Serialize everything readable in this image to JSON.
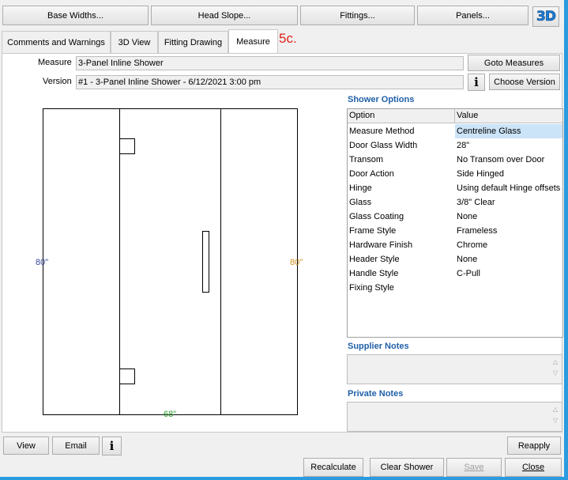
{
  "toolbar": {
    "base_widths": "Base Widths...",
    "head_slope": "Head Slope...",
    "fittings": "Fittings...",
    "panels": "Panels...",
    "view_3d": "3D"
  },
  "tabs": [
    {
      "label": "Comments and Warnings"
    },
    {
      "label": "3D View"
    },
    {
      "label": "Fitting Drawing"
    },
    {
      "label": "Measure",
      "active": true
    }
  ],
  "annotation": "5c.",
  "measure": {
    "measure_label": "Measure",
    "measure_value": "3-Panel Inline Shower",
    "goto_button": "Goto Measures",
    "version_label": "Version",
    "version_value": "#1 - 3-Panel Inline Shower - 6/12/2021 3:00 pm",
    "info_glyph": "i",
    "choose_version_button": "Choose Version"
  },
  "drawing": {
    "left_dim": "80\"",
    "right_dim": "80\"",
    "bottom_dim": "68\"",
    "colors": {
      "left": "#3a4aa0",
      "right": "#d4901e",
      "bottom": "#2e9e2e",
      "outline": "#000000"
    }
  },
  "shower_options": {
    "title": "Shower Options",
    "columns": [
      "Option",
      "Value"
    ],
    "rows": [
      {
        "option": "Measure Method",
        "value": "Centreline Glass",
        "selected": true
      },
      {
        "option": "Door Glass Width",
        "value": "28\""
      },
      {
        "option": "Transom",
        "value": "No Transom over Door"
      },
      {
        "option": "Door Action",
        "value": "Side Hinged"
      },
      {
        "option": "Hinge",
        "value": "Using default Hinge offsets"
      },
      {
        "option": "Glass",
        "value": "3/8\" Clear"
      },
      {
        "option": "Glass Coating",
        "value": "None"
      },
      {
        "option": "Frame Style",
        "value": "Frameless"
      },
      {
        "option": "Hardware Finish",
        "value": "Chrome"
      },
      {
        "option": "Header Style",
        "value": "None"
      },
      {
        "option": "Handle Style",
        "value": "C-Pull"
      },
      {
        "option": "Fixing Style",
        "value": ""
      }
    ]
  },
  "supplier_notes": {
    "title": "Supplier Notes"
  },
  "private_notes": {
    "title": "Private Notes"
  },
  "bottom": {
    "view": "View",
    "email": "Email",
    "info_glyph": "i",
    "reapply": "Reapply"
  },
  "footer": {
    "recalculate": "Recalculate",
    "clear_shower": "Clear Shower",
    "save": "Save",
    "close": "Close"
  },
  "accent_color": "#1f5fa8",
  "background_color": "#2b9be0"
}
